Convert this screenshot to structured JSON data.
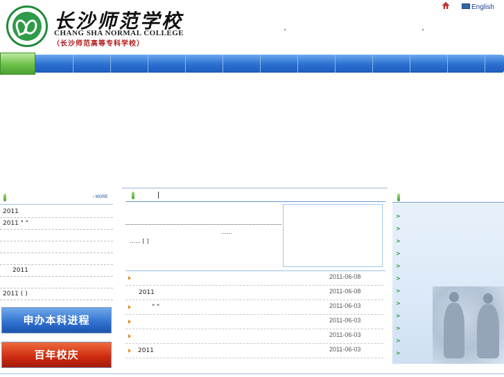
{
  "header": {
    "logo_cn": "长沙师范学校",
    "logo_en": "CHANG SHA NORMAL COLLEGE",
    "logo_sub": "（长沙师范高等专科学校）",
    "english_label": "English"
  },
  "left": {
    "more_label": "MORE",
    "items": [
      "2011",
      "2011 \" \"",
      "",
      "",
      "",
      "2011",
      "",
      "2011      (   )"
    ],
    "banner_1": "申办本科进程",
    "banner_2": "百年校庆"
  },
  "middle": {
    "ellipsis": "……",
    "more": "…… [ ]",
    "news": [
      {
        "title": "",
        "date": "2011-06-08"
      },
      {
        "title": "2011",
        "date": "2011-06-08"
      },
      {
        "title": "       \" \"",
        "date": "2011-06-03"
      },
      {
        "title": "",
        "date": "2011-06-03"
      },
      {
        "title": "",
        "date": "2011-06-03"
      },
      {
        "title": "2011",
        "date": "2011-06-03"
      }
    ]
  },
  "right": {
    "arrow": ">",
    "item_count_label": ""
  },
  "colors": {
    "nav_blue": "#2b6fd0",
    "nav_green": "#6cc04a",
    "link_blue": "#1a4fa0",
    "bullet_orange": "#e48a1a"
  }
}
